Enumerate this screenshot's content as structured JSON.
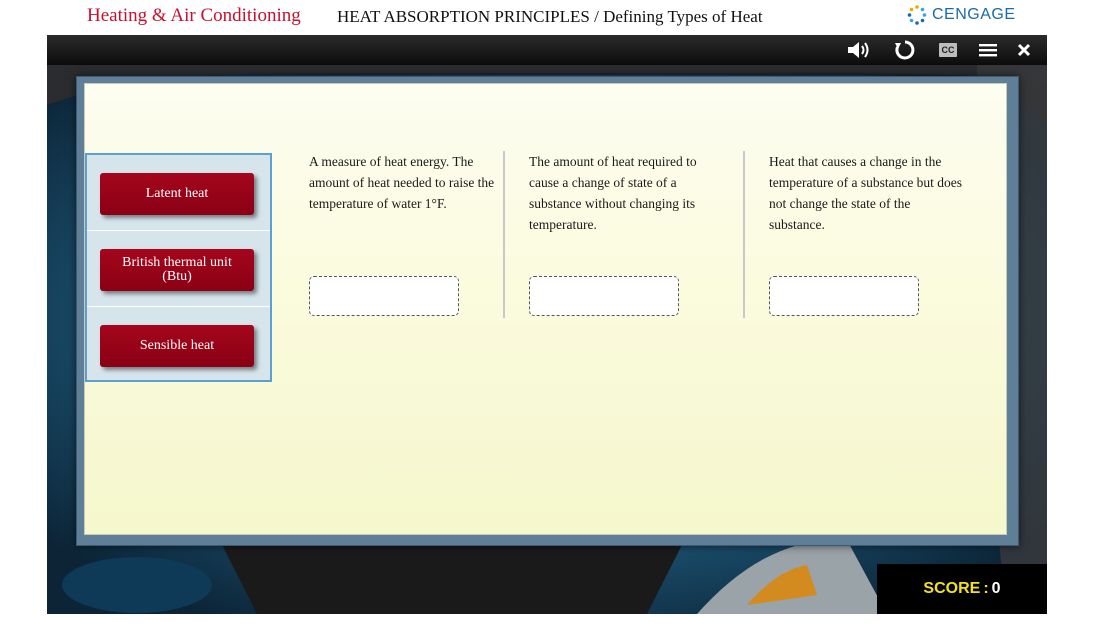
{
  "header": {
    "course_title": "Heating & Air Conditioning",
    "lesson_title": "HEAT ABSORPTION PRINCIPLES / Defining Types of Heat",
    "brand": "CENGAGE"
  },
  "toolbar": {
    "items": [
      {
        "name": "audio",
        "icon": "speaker-icon"
      },
      {
        "name": "replay",
        "icon": "replay-icon"
      },
      {
        "name": "captions",
        "icon": "cc-icon",
        "label": "CC"
      },
      {
        "name": "menu",
        "icon": "hamburger-icon"
      },
      {
        "name": "close",
        "icon": "close-icon"
      }
    ]
  },
  "activity": {
    "terms": [
      {
        "label": "Latent heat"
      },
      {
        "label": "British thermal unit\n(Btu)"
      },
      {
        "label": "Sensible heat"
      }
    ],
    "definitions": [
      {
        "text": "A measure of heat energy. The amount of heat needed to raise the temperature of water 1°F.",
        "drop_value": ""
      },
      {
        "text": "The amount of heat required to cause a change of state of a substance without changing its temperature.",
        "drop_value": ""
      },
      {
        "text": "Heat that causes a change in the temperature of a substance but does not change the state of the substance.",
        "drop_value": ""
      }
    ]
  },
  "score": {
    "label": "SCORE",
    "separator": ":",
    "value": "0"
  },
  "colors": {
    "course_title": "#c8102e",
    "term_button": "#9a0018",
    "score_label": "#f1e219",
    "brand": "#1a6aa8"
  }
}
